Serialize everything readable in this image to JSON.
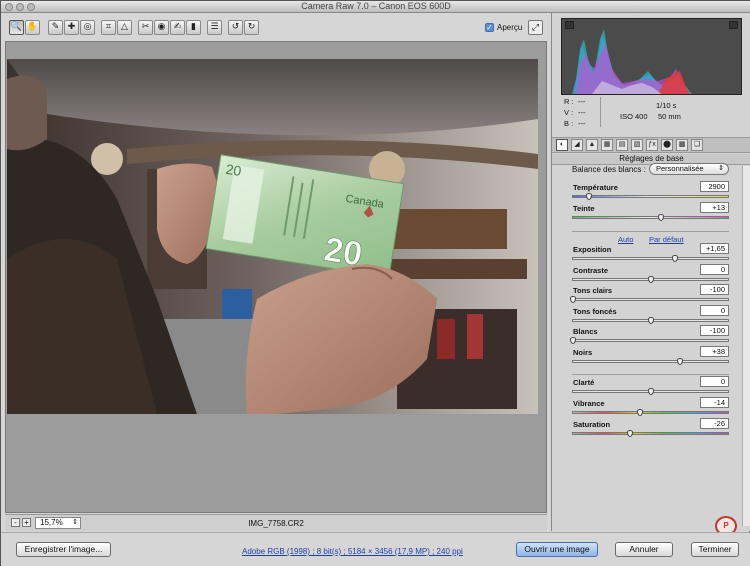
{
  "window": {
    "title": "Camera Raw 7.0  –  Canon EOS 600D"
  },
  "toolbar": {
    "tools": [
      {
        "icon": "zoom-icon",
        "glyph": "🔍"
      },
      {
        "icon": "hand-icon",
        "glyph": "✋"
      },
      {
        "icon": "white-balance-icon",
        "glyph": "✎"
      },
      {
        "icon": "color-sampler-icon",
        "glyph": "✚"
      },
      {
        "icon": "targeted-adjustment-icon",
        "glyph": "◎"
      },
      {
        "icon": "crop-icon",
        "glyph": "⌗"
      },
      {
        "icon": "straighten-icon",
        "glyph": "△"
      },
      {
        "icon": "spot-removal-icon",
        "glyph": "✂"
      },
      {
        "icon": "red-eye-icon",
        "glyph": "◉"
      },
      {
        "icon": "adjustment-brush-icon",
        "glyph": "✍"
      },
      {
        "icon": "graduated-filter-icon",
        "glyph": "▮"
      },
      {
        "icon": "preferences-icon",
        "glyph": "☰"
      },
      {
        "icon": "rotate-left-icon",
        "glyph": "↺"
      },
      {
        "icon": "rotate-right-icon",
        "glyph": "↻"
      }
    ],
    "preview_label": "Aperçu",
    "preview_checked": "✓",
    "fullscreen_glyph": "⤢"
  },
  "status": {
    "zoom_out": "-",
    "zoom_in": "+",
    "zoom": "15,7%",
    "zoom_arrow": "⇕",
    "filename": "IMG_7758.CR2"
  },
  "bottom": {
    "save": "Enregistrer l'image...",
    "workflow": "Adobe RGB (1998) ; 8 bit(s) ; 5184 × 3456 (17,9 MP) ; 240 ppi",
    "open": "Ouvrir une image",
    "cancel": "Annuler",
    "done": "Terminer"
  },
  "readout": {
    "r_label": "R :",
    "r_value": "---",
    "v_label": "V :",
    "v_value": "---",
    "b_label": "B :",
    "b_value": "---",
    "shutter": "1/10 s",
    "iso": "ISO 400",
    "focal": "50 mm"
  },
  "panel": {
    "tabs": [
      "◐",
      "◢",
      "▲",
      "▦",
      "▤",
      "▧",
      "ƒx",
      "⬤",
      "▩",
      "❏"
    ],
    "title": "Réglages de base",
    "wb_label": "Balance des blancs :",
    "wb_value": "Personnalisée",
    "wb_arrow": "⇕",
    "auto": "Auto",
    "default": "Par défaut",
    "sliders": [
      {
        "label": "Température",
        "value": "2900",
        "pos": 0.1
      },
      {
        "label": "Teinte",
        "value": "+13",
        "pos": 0.57
      },
      {
        "label": "Exposition",
        "value": "+1,65",
        "pos": 0.66
      },
      {
        "label": "Contraste",
        "value": "0",
        "pos": 0.5
      },
      {
        "label": "Tons clairs",
        "value": "-100",
        "pos": 0.0
      },
      {
        "label": "Tons foncés",
        "value": "0",
        "pos": 0.5
      },
      {
        "label": "Blancs",
        "value": "-100",
        "pos": 0.0
      },
      {
        "label": "Noirs",
        "value": "+38",
        "pos": 0.69
      },
      {
        "label": "Clarté",
        "value": "0",
        "pos": 0.5
      },
      {
        "label": "Vibrance",
        "value": "-14",
        "pos": 0.43
      },
      {
        "label": "Saturation",
        "value": "-26",
        "pos": 0.37
      }
    ],
    "logo": "P"
  },
  "photo": {
    "banknote_word": "Canada",
    "banknote_value": "20",
    "banknote_corner": "20"
  }
}
